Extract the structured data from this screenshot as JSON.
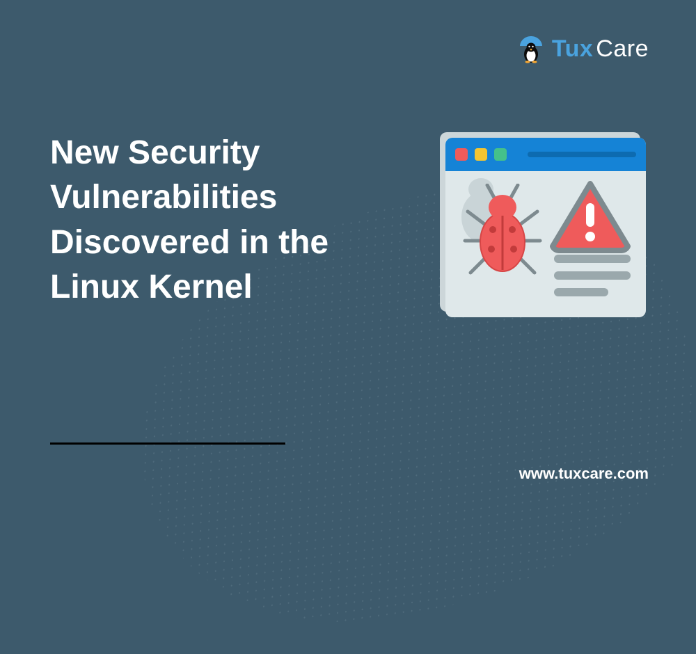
{
  "logo": {
    "brand_part1": "Tux",
    "brand_part2": "Care"
  },
  "headline": "New Security Vulnerabilities Discovered in the Linux Kernel",
  "website_url": "www.tuxcare.com",
  "illustration": {
    "window_dots": [
      "red",
      "yellow",
      "green"
    ],
    "bug_icon": "bug-icon",
    "warning_icon": "warning-triangle-icon"
  },
  "colors": {
    "background": "#3d5a6c",
    "accent_blue": "#1583d6",
    "logo_blue": "#4aa3df",
    "bug_red": "#ef5b5b",
    "warn_red": "#ef5b5b",
    "text_white": "#ffffff"
  }
}
